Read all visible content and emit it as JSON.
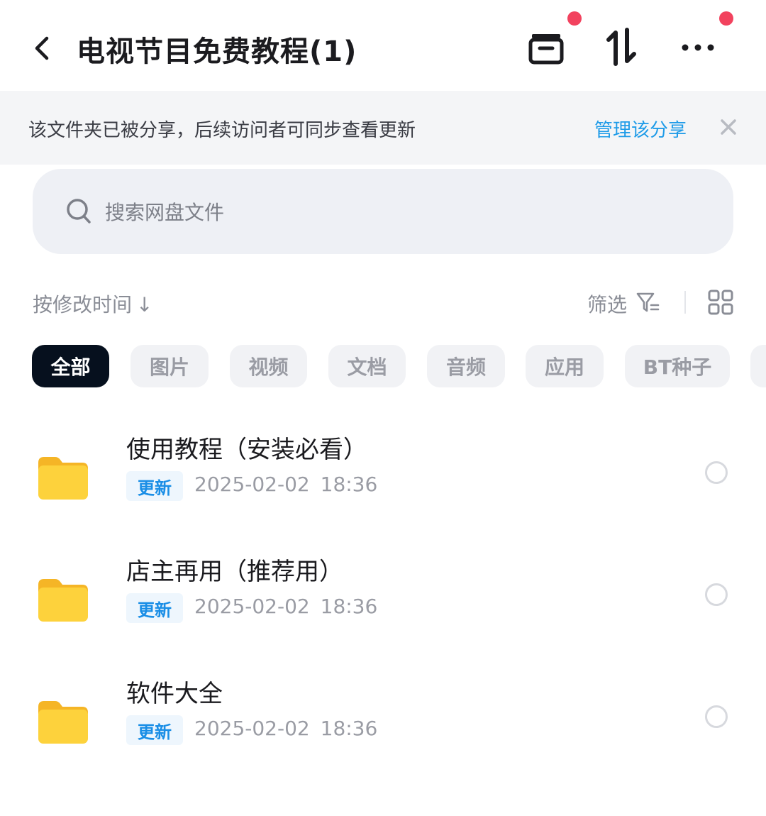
{
  "header": {
    "title": "电视节目免费教程(1)",
    "icons": [
      "back-icon",
      "archive-icon",
      "transfer-icon",
      "more-icon"
    ],
    "notification_dot_color": "#f2425e"
  },
  "notice": {
    "text": "该文件夹已被分享，后续访问者可同步查看更新",
    "link": "管理该分享",
    "link_color": "#1e9be8"
  },
  "search": {
    "placeholder": "搜索网盘文件"
  },
  "toolbar": {
    "sort_label": "按修改时间",
    "sort_arrow": "↓",
    "filter_label": "筛选"
  },
  "chips": [
    {
      "label": "全部",
      "active": true
    },
    {
      "label": "图片",
      "active": false
    },
    {
      "label": "视频",
      "active": false
    },
    {
      "label": "文档",
      "active": false
    },
    {
      "label": "音频",
      "active": false
    },
    {
      "label": "应用",
      "active": false
    },
    {
      "label": "BT种子",
      "active": false
    }
  ],
  "files": [
    {
      "name": "使用教程（安装必看）",
      "badge": "更新",
      "date": "2025-02-02 18:36"
    },
    {
      "name": "店主再用（推荐用）",
      "badge": "更新",
      "date": "2025-02-02 18:36"
    },
    {
      "name": "软件大全",
      "badge": "更新",
      "date": "2025-02-02 18:36"
    }
  ]
}
